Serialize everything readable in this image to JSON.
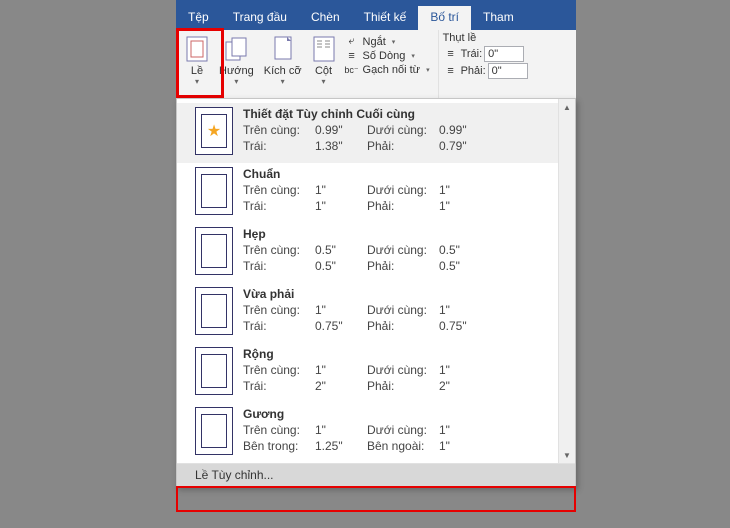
{
  "tabs": {
    "file": "Tệp",
    "home": "Trang đầu",
    "insert": "Chèn",
    "design": "Thiết kế",
    "layout": "Bố trí",
    "references": "Tham"
  },
  "ribbon": {
    "margins": "Lề",
    "orientation": "Hướng",
    "size": "Kích cỡ",
    "columns": "Cột",
    "breaks": "Ngắt",
    "lineNumbers": "Số Dòng",
    "hyphenation": "Gạch nối từ"
  },
  "indent": {
    "title": "Thụt lề",
    "left_lbl": "Trái:",
    "left_val": "0\"",
    "right_lbl": "Phải:",
    "right_val": "0\""
  },
  "margins_menu": {
    "items": [
      {
        "title": "Thiết đặt Tùy chỉnh Cuối cùng",
        "r1a": "Trên cùng:",
        "r1b": "0.99\"",
        "r1c": "Dưới cùng:",
        "r1d": "0.99\"",
        "r2a": "Trái:",
        "r2b": "1.38\"",
        "r2c": "Phải:",
        "r2d": "0.79\"",
        "star": true
      },
      {
        "title": "Chuẩn",
        "r1a": "Trên cùng:",
        "r1b": "1\"",
        "r1c": "Dưới cùng:",
        "r1d": "1\"",
        "r2a": "Trái:",
        "r2b": "1\"",
        "r2c": "Phải:",
        "r2d": "1\""
      },
      {
        "title": "Hẹp",
        "r1a": "Trên cùng:",
        "r1b": "0.5\"",
        "r1c": "Dưới cùng:",
        "r1d": "0.5\"",
        "r2a": "Trái:",
        "r2b": "0.5\"",
        "r2c": "Phải:",
        "r2d": "0.5\""
      },
      {
        "title": "Vừa phải",
        "r1a": "Trên cùng:",
        "r1b": "1\"",
        "r1c": "Dưới cùng:",
        "r1d": "1\"",
        "r2a": "Trái:",
        "r2b": "0.75\"",
        "r2c": "Phải:",
        "r2d": "0.75\""
      },
      {
        "title": "Rộng",
        "r1a": "Trên cùng:",
        "r1b": "1\"",
        "r1c": "Dưới cùng:",
        "r1d": "1\"",
        "r2a": "Trái:",
        "r2b": "2\"",
        "r2c": "Phải:",
        "r2d": "2\""
      },
      {
        "title": "Gương",
        "r1a": "Trên cùng:",
        "r1b": "1\"",
        "r1c": "Dưới cùng:",
        "r1d": "1\"",
        "r2a": "Bên trong:",
        "r2b": "1.25\"",
        "r2c": "Bên ngoài:",
        "r2d": "1\""
      }
    ],
    "custom": "Lề Tùy chỉnh..."
  }
}
